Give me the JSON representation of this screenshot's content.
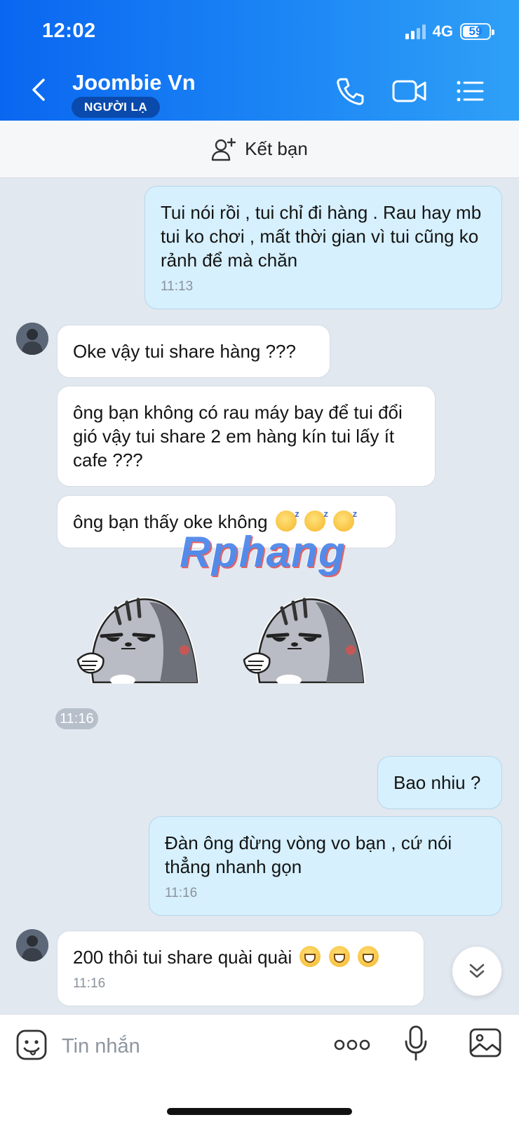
{
  "status_bar": {
    "time": "12:02",
    "network": "4G",
    "battery": "59"
  },
  "header": {
    "title": "Joombie Vn",
    "badge": "NGƯỜI LẠ"
  },
  "friend_bar": {
    "label": "Kết bạn"
  },
  "messages": [
    {
      "from": "me",
      "text": "Tui nói rồi , tui chỉ đi hàng . Rau hay mb tui ko chơi , mất thời gian vì tui cũng ko rảnh để mà chăn",
      "time": "11:13"
    },
    {
      "from": "them",
      "text": "Oke vậy tui share hàng ???"
    },
    {
      "from": "them",
      "text": "ông bạn không có rau máy bay để tui đổi gió vậy tui share 2 em hàng kín tui lấy ít cafe ???"
    },
    {
      "from": "them",
      "text": "ông bạn thấy oke không",
      "emojis": [
        "sleepy",
        "sleepy",
        "sleepy"
      ]
    },
    {
      "from": "them",
      "type": "stickers",
      "count": 2,
      "time": "11:16"
    },
    {
      "from": "me",
      "text": "Bao nhiu ?"
    },
    {
      "from": "me",
      "text": "Đàn ông đừng vòng vo bạn , cứ nói thẳng nhanh gọn",
      "time": "11:16"
    },
    {
      "from": "them",
      "text": "200 thôi tui share quài quài",
      "emojis": [
        "grin",
        "grin",
        "grin"
      ],
      "time": "11:16"
    }
  ],
  "watermark": "Rphang",
  "input": {
    "placeholder": "Tin nhắn"
  },
  "colors": {
    "header_start": "#0a66f0",
    "header_end": "#2fa0f7",
    "my_bubble": "#d6f0fd",
    "their_bubble": "#ffffff",
    "chat_bg": "#e2e8f0"
  }
}
